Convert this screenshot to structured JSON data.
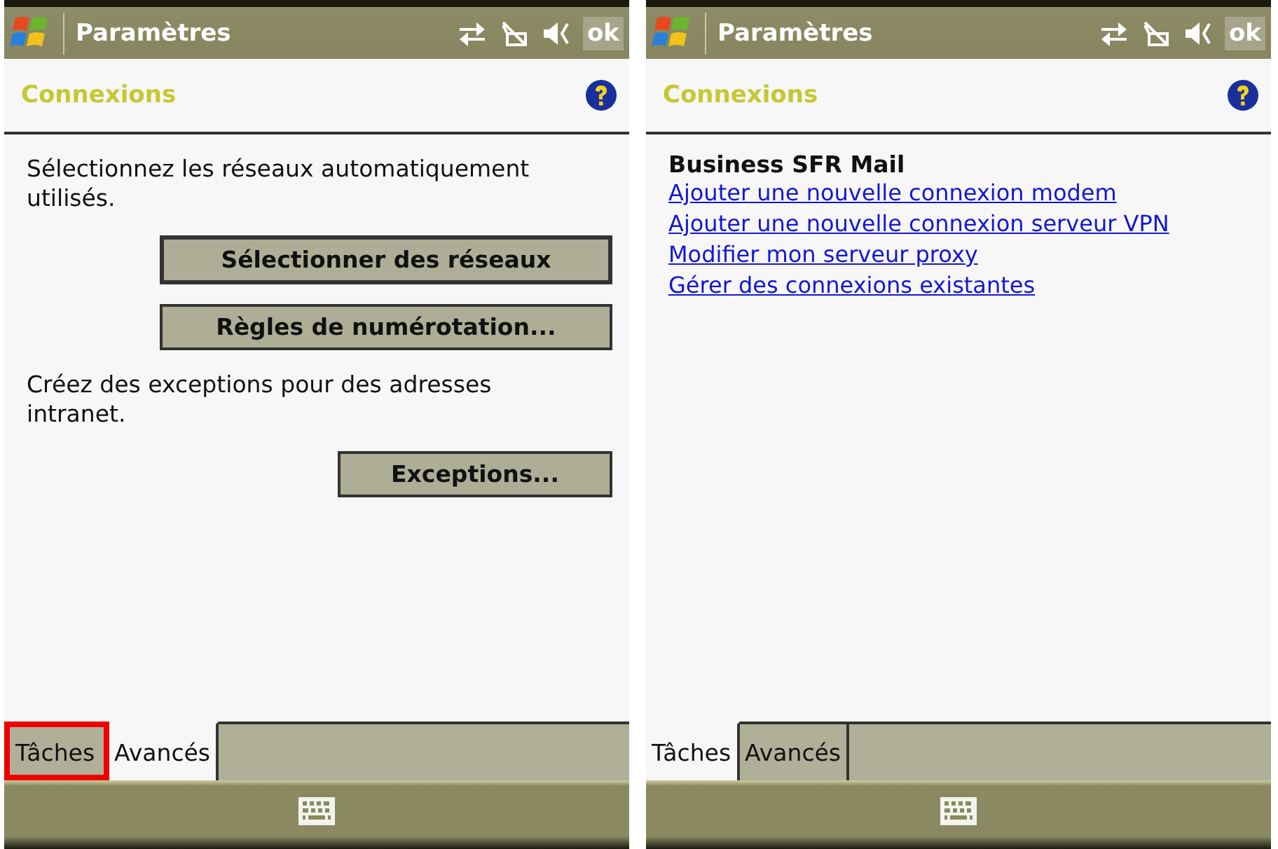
{
  "screens": [
    {
      "title": "Paramètres",
      "ok": "ok",
      "header": "Connexions",
      "content": {
        "kind": "options",
        "blocks": [
          {
            "kind": "text",
            "text": "Sélectionnez les réseaux automatiquement utilisés."
          },
          {
            "kind": "button",
            "label": "Sélectionner des réseaux",
            "focused": true
          },
          {
            "kind": "button",
            "label": "Règles de numérotation...",
            "focused": false
          },
          {
            "kind": "text",
            "text": "Créez des exceptions pour des adresses intranet."
          },
          {
            "kind": "button",
            "label": "Exceptions...",
            "focused": false
          }
        ]
      },
      "tabs": [
        {
          "label": "Tâches",
          "selected": false,
          "highlighted": true
        },
        {
          "label": "Avancés",
          "selected": true,
          "highlighted": false
        }
      ]
    },
    {
      "title": "Paramètres",
      "ok": "ok",
      "header": "Connexions",
      "content": {
        "kind": "links",
        "heading": "Business SFR Mail",
        "links": [
          "Ajouter une nouvelle connexion modem",
          "Ajouter une nouvelle connexion serveur VPN",
          "Modifier mon serveur proxy",
          "Gérer des connexions existantes"
        ]
      },
      "tabs": [
        {
          "label": "Tâches",
          "selected": true,
          "highlighted": false
        },
        {
          "label": "Avancés",
          "selected": false,
          "highlighted": false
        }
      ]
    }
  ]
}
